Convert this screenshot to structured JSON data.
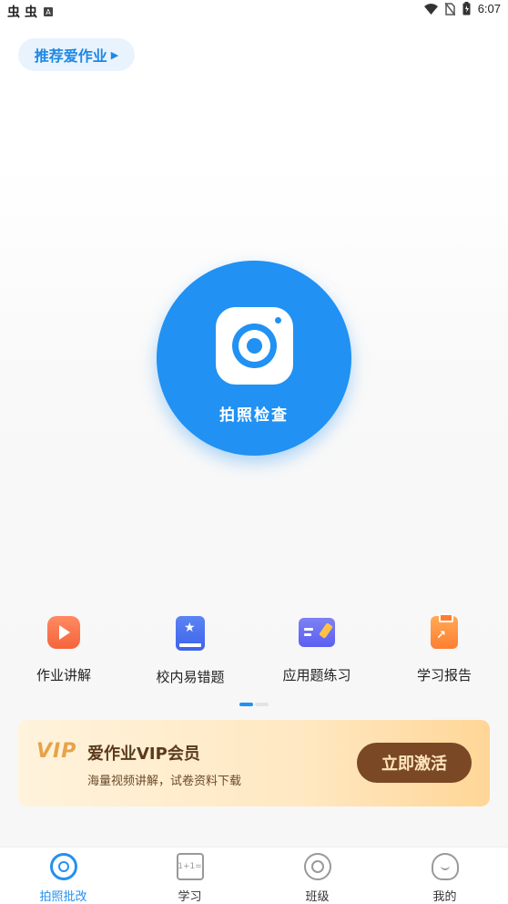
{
  "status_bar": {
    "left_glyphs": [
      "虫",
      "虫"
    ],
    "time": "6:07"
  },
  "recommend": {
    "label": "推荐爱作业"
  },
  "camera": {
    "label": "拍照检查",
    "accent_color": "#2191f3"
  },
  "features": [
    {
      "label": "作业讲解",
      "icon": "video-play-icon"
    },
    {
      "label": "校内易错题",
      "icon": "star-book-icon"
    },
    {
      "label": "应用题练习",
      "icon": "practice-pen-icon"
    },
    {
      "label": "学习报告",
      "icon": "report-clipboard-icon"
    }
  ],
  "pager": {
    "pages": 2,
    "active": 1
  },
  "vip": {
    "logo": "VIP",
    "title": "爱作业VIP会员",
    "subtitle": "海量视频讲解，试卷资料下载",
    "button": "立即激活"
  },
  "nav": [
    {
      "label": "拍照批改",
      "active": true
    },
    {
      "label": "学习",
      "active": false
    },
    {
      "label": "班级",
      "active": false
    },
    {
      "label": "我的",
      "active": false
    }
  ]
}
